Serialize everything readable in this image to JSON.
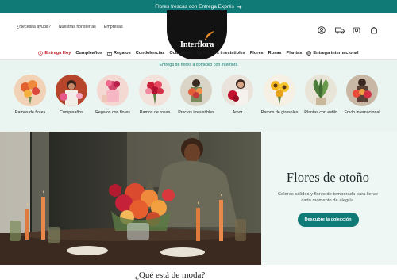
{
  "promo_banner": {
    "text": "Flores frescas con Entrega Exprés",
    "arrow": "➜"
  },
  "header": {
    "links": [
      "¿Necesita ayuda?",
      "Nuestras floristerías",
      "Empresas"
    ],
    "logo": "Interflora",
    "icons": [
      "user-icon",
      "delivery-truck-icon",
      "wallet-icon",
      "shopping-bag-icon"
    ]
  },
  "nav": {
    "items": [
      {
        "label": "Entrega Hoy",
        "icon": "clock-icon",
        "highlight": true
      },
      {
        "label": "Cumpleaños"
      },
      {
        "label": "Regalos",
        "icon": "gift-icon"
      },
      {
        "label": "Condolencias"
      },
      {
        "label": "Ocasiones"
      },
      {
        "label": "Precios irresistibles",
        "icon": "tag-icon"
      },
      {
        "label": "Flores"
      },
      {
        "label": "Rosas"
      },
      {
        "label": "Plantas"
      },
      {
        "label": "Entrega internacional",
        "icon": "globe-icon"
      }
    ]
  },
  "subbar": {
    "text": "Entrega de flores a domicilio con interflora"
  },
  "categories": [
    {
      "label": "Ramos de flores"
    },
    {
      "label": "Cumpleaños"
    },
    {
      "label": "Regalos con flores"
    },
    {
      "label": "Ramos de rosas"
    },
    {
      "label": "Precios irresistibles"
    },
    {
      "label": "Amor"
    },
    {
      "label": "Ramos de girasoles"
    },
    {
      "label": "Plantas con estilo"
    },
    {
      "label": "Envío internacional"
    }
  ],
  "hero": {
    "title": "Flores de otoño",
    "subtitle": "Colores cálidos y flores de temporada para llenar cada momento de alegría.",
    "button": "Descubre la colección"
  },
  "next_section": {
    "title": "¿Qué está de moda?"
  },
  "colors": {
    "brand": "#0f7a76",
    "highlight": "#c1272d",
    "logo_bg": "#121212",
    "mint": "#eaf4f1"
  }
}
